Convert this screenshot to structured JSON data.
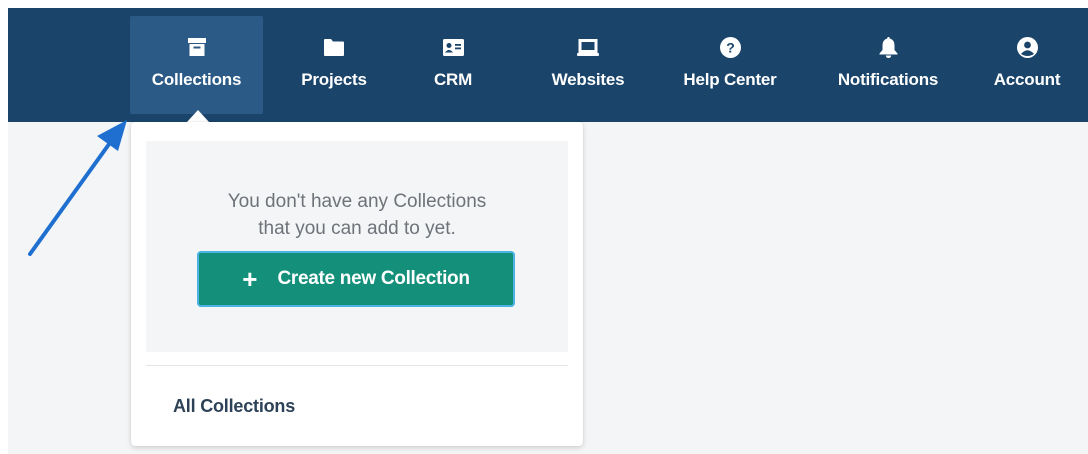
{
  "nav": {
    "items": [
      {
        "label": "Collections",
        "icon": "archive-box-icon"
      },
      {
        "label": "Projects",
        "icon": "folder-icon"
      },
      {
        "label": "CRM",
        "icon": "contact-card-icon"
      },
      {
        "label": "Websites",
        "icon": "laptop-icon"
      },
      {
        "label": "Help Center",
        "icon": "question-circle-icon"
      },
      {
        "label": "Notifications",
        "icon": "bell-icon"
      },
      {
        "label": "Account",
        "icon": "user-circle-icon"
      }
    ],
    "active_index": 0
  },
  "dropdown": {
    "empty_message_line1": "You don't have any Collections",
    "empty_message_line2": "that you can add to yet.",
    "create_button_icon": "+",
    "create_button_label": "Create new Collection",
    "all_collections_link": "All Collections"
  },
  "colors": {
    "navbar": "#1a4469",
    "active_nav_item": "#2b5a87",
    "create_button": "#14907a",
    "annotation_arrow": "#1f6fd1"
  }
}
